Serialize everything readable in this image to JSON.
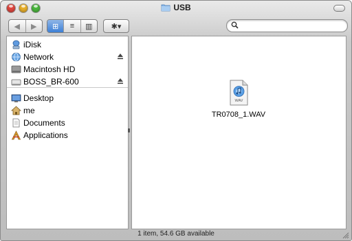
{
  "window": {
    "title": "USB"
  },
  "toolbar": {
    "back_glyph": "◀",
    "forward_glyph": "▶",
    "view_icon": "⊞",
    "view_list": "≡",
    "view_columns": "▥",
    "action_glyph": "✱▾",
    "search_placeholder": ""
  },
  "sidebar": {
    "items": [
      {
        "label": "iDisk",
        "icon": "idisk-icon"
      },
      {
        "label": "Network",
        "icon": "network-globe-icon",
        "eject": true
      },
      {
        "label": "Macintosh HD",
        "icon": "hard-drive-icon"
      },
      {
        "label": "BOSS_BR-600",
        "icon": "external-drive-icon",
        "eject": true
      },
      {
        "label": "Desktop",
        "icon": "desktop-icon"
      },
      {
        "label": "me",
        "icon": "home-icon"
      },
      {
        "label": "Documents",
        "icon": "documents-icon"
      },
      {
        "label": "Applications",
        "icon": "applications-icon"
      }
    ]
  },
  "content": {
    "files": [
      {
        "name": "TR0708_1.WAV",
        "badge": "WAV"
      }
    ]
  },
  "status": {
    "text": "1 item, 54.6 GB available"
  },
  "colors": {
    "accent": "#3d7fd6",
    "close": "#e0473f",
    "minimize": "#e9b02b",
    "zoom": "#4bb83e"
  }
}
